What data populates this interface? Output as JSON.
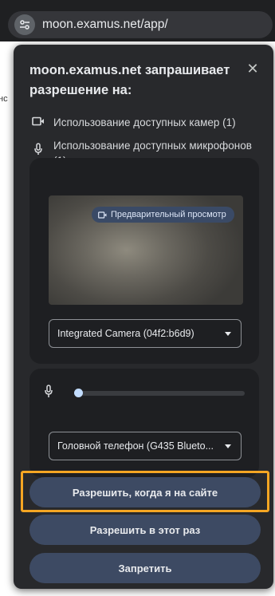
{
  "addressbar": {
    "url": "moon.examus.net/app/",
    "icon": "tune-icon"
  },
  "page": {
    "edge_text": "нс"
  },
  "popup": {
    "title_site": "moon.examus.net",
    "title_rest": " запрашивает разрешение на:",
    "close_label": "✕",
    "permissions": [
      {
        "icon": "videocam-icon",
        "label": "Использование доступных камер (1)"
      },
      {
        "icon": "mic-icon",
        "label": "Использование доступных микрофонов (1)"
      }
    ],
    "camera": {
      "preview_badge": "Предварительный просмотр",
      "select_value": "Integrated Camera (04f2:b6d9)"
    },
    "microphone": {
      "level": 0.03,
      "select_value": "Головной телефон (G435 Blueto..."
    },
    "buttons": {
      "allow_while_visiting": "Разрешить, когда я на сайте",
      "allow_this_time": "Разрешить в этот раз",
      "deny": "Запретить"
    },
    "colors": {
      "highlight": "#f5a623",
      "button_bg": "#3d4a63",
      "popup_bg": "#28292c"
    }
  }
}
